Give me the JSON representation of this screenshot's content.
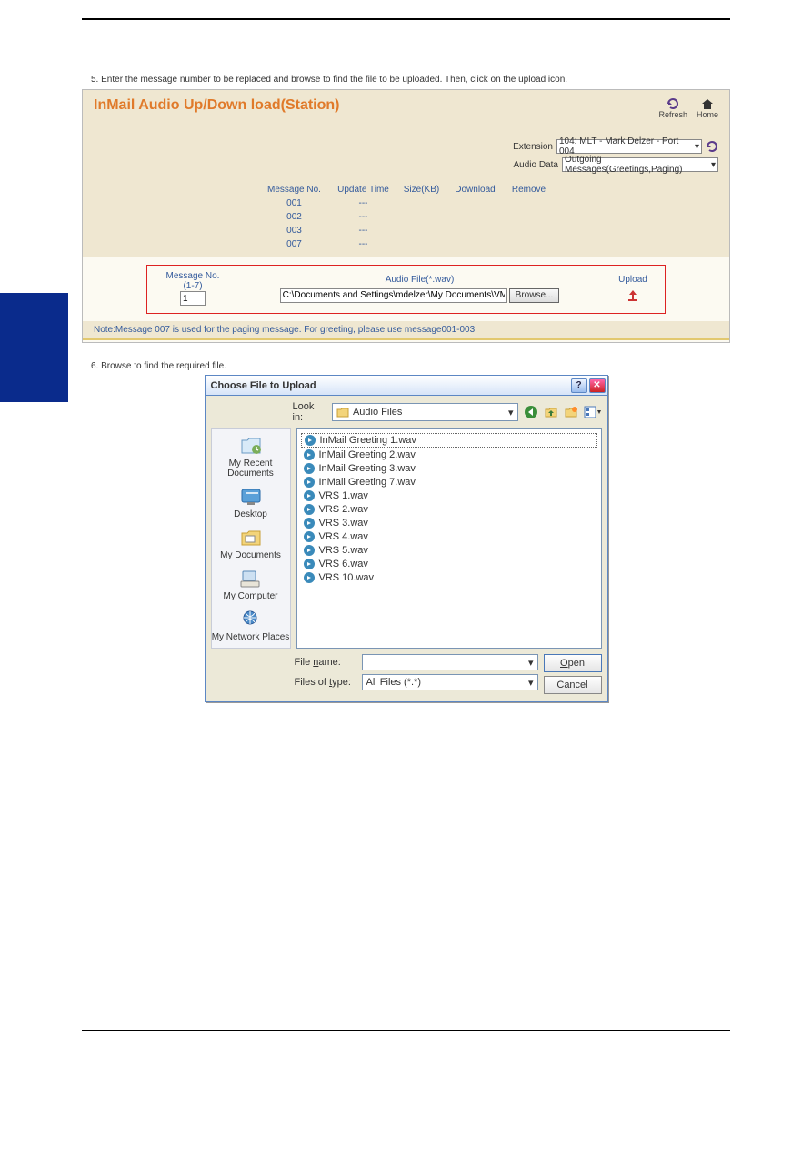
{
  "header_line": "5. Enter the message number to be replaced and browse to find the file to be uploaded. Then, click on the upload icon.",
  "inmail": {
    "title": "InMail Audio Up/Down load(Station)",
    "toolbar": {
      "refresh": "Refresh",
      "home": "Home"
    },
    "selectors": {
      "extension_label": "Extension",
      "extension_value": "104: MLT - Mark Delzer - Port 004",
      "audio_data_label": "Audio Data",
      "audio_data_value": "Outgoing Messages(Greetings,Paging)"
    },
    "table_head": {
      "no": "Message No.",
      "time": "Update Time",
      "size": "Size(KB)",
      "dl": "Download",
      "rm": "Remove"
    },
    "rows": [
      {
        "no": "001",
        "time": "---"
      },
      {
        "no": "002",
        "time": "---"
      },
      {
        "no": "003",
        "time": "---"
      },
      {
        "no": "007",
        "time": "---"
      }
    ],
    "upload": {
      "msg_no_label_1": "Message No.",
      "msg_no_label_2": "(1-7)",
      "msg_no_value": "1",
      "audio_file_label": "Audio File(*.wav)",
      "path_value": "C:\\Documents and Settings\\mdelzer\\My Documents\\VM",
      "browse_label": "Browse...",
      "upload_label": "Upload"
    },
    "note": "Note:Message 007 is used for the paging message. For greeting, please use message001-003."
  },
  "body_line": "6. Browse to find the required file.",
  "dialog": {
    "title": "Choose File to Upload",
    "look_in_label": "Look in:",
    "look_in_value": "Audio Files",
    "places": {
      "recent": "My Recent Documents",
      "desktop": "Desktop",
      "mydocs": "My Documents",
      "mycomp": "My Computer",
      "network": "My Network Places"
    },
    "files": [
      "InMail Greeting 1.wav",
      "InMail Greeting 2.wav",
      "InMail Greeting 3.wav",
      "InMail Greeting 7.wav",
      "VRS 1.wav",
      "VRS 2.wav",
      "VRS 3.wav",
      "VRS 4.wav",
      "VRS 5.wav",
      "VRS 6.wav",
      "VRS 10.wav"
    ],
    "file_name_label": "File name:",
    "file_type_label": "Files of type:",
    "file_type_value": "All Files (*.*)",
    "open_btn": "Open",
    "cancel_btn": "Cancel"
  }
}
